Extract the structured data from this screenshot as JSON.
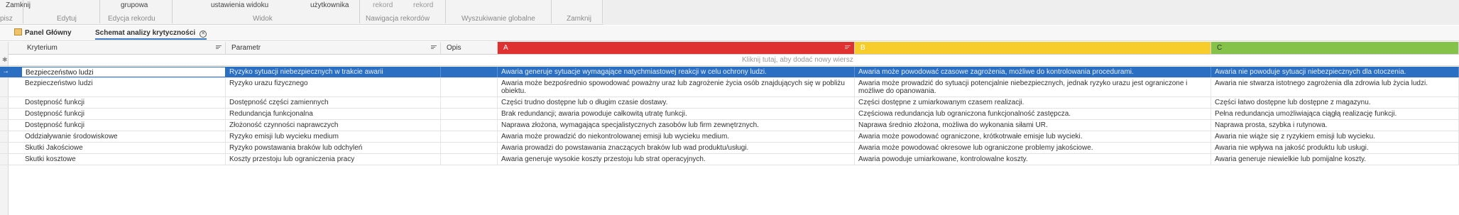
{
  "ribbon": {
    "buttons": {
      "save_close": "Zamknij",
      "grouping": "grupowa",
      "view_settings": "ustawienia widoku",
      "user": "użytkownika",
      "prev_record": "rekord",
      "next_record": "rekord"
    },
    "groups": {
      "write": "pisz",
      "edit": "Edytuj",
      "record_edit": "Edycja rekordu",
      "view": "Widok",
      "record_nav": "Nawigacja rekordów",
      "global_search": "Wyszukiwanie globalne",
      "close": "Zamknij"
    }
  },
  "tabs": [
    {
      "label": "Panel Główny",
      "icon": "panel-icon"
    },
    {
      "label": "Schemat analizy krytyczności",
      "icon": "close-icon"
    }
  ],
  "grid": {
    "columns": {
      "kryterium": "Kryterium",
      "parametr": "Parametr",
      "opis": "Opis",
      "a": "A",
      "b": "B",
      "c": "C"
    },
    "colors": {
      "a": "#e03131",
      "b": "#f7cd2c",
      "c": "#84c24a",
      "selection": "#2a6fc2"
    },
    "new_row_hint": "Kliknij tutaj, aby dodać nowy wiersz",
    "rows": [
      {
        "kryterium": "Bezpieczeństwo ludzi",
        "parametr": "Ryzyko sytuacji niebezpiecznych w trakcie awarii",
        "opis": "",
        "a": "Awaria generuje sytuacje wymagające natychmiastowej reakcji w celu ochrony ludzi.",
        "b": "Awaria może powodować czasowe zagrożenia, możliwe do kontrolowania procedurami.",
        "c": "Awaria nie powoduje sytuacji niebezpiecznych dla otoczenia."
      },
      {
        "kryterium": "Bezpieczeństwo ludzi",
        "parametr": "Ryzyko urazu fizycznego",
        "opis": "",
        "a": "Awaria może bezpośrednio spowodować poważny uraz lub zagrożenie życia osób znajdujących się w pobliżu obiektu.",
        "b": "Awaria może prowadzić do sytuacji potencjalnie niebezpiecznych, jednak ryzyko urazu jest ograniczone i możliwe do opanowania.",
        "c": "Awaria nie stwarza istotnego zagrożenia dla zdrowia lub życia ludzi."
      },
      {
        "kryterium": "Dostępność funkcji",
        "parametr": "Dostępność części zamiennych",
        "opis": "",
        "a": "Części trudno dostępne lub o długim czasie dostawy.",
        "b": "Części dostępne z umiarkowanym czasem realizacji.",
        "c": "Części łatwo dostępne lub dostępne z magazynu."
      },
      {
        "kryterium": "Dostępność funkcji",
        "parametr": "Redundancja funkcjonalna",
        "opis": "",
        "a": "Brak redundancji; awaria powoduje całkowitą utratę funkcji.",
        "b": "Częściowa redundancja lub ograniczona funkcjonalność zastępcza.",
        "c": "Pełna redundancja umożliwiająca ciągłą realizację funkcji."
      },
      {
        "kryterium": "Dostępność funkcji",
        "parametr": "Złożoność czynności naprawczych",
        "opis": "",
        "a": "Naprawa złożona, wymagająca specjalistycznych zasobów lub firm zewnętrznych.",
        "b": "Naprawa średnio złożona, możliwa do wykonania siłami UR.",
        "c": "Naprawa prosta, szybka i rutynowa."
      },
      {
        "kryterium": "Oddziaływanie środowiskowe",
        "parametr": "Ryzyko emisji lub wycieku medium",
        "opis": "",
        "a": "Awaria może prowadzić do niekontrolowanej emisji lub wycieku medium.",
        "b": "Awaria może powodować ograniczone, krótkotrwałe emisje lub wycieki.",
        "c": "Awaria nie wiąże się z ryzykiem emisji lub wycieku."
      },
      {
        "kryterium": "Skutki Jakościowe",
        "parametr": "Ryzyko powstawania braków lub odchyleń",
        "opis": "",
        "a": "Awaria prowadzi do powstawania znaczących braków lub wad produktu/usługi.",
        "b": "Awaria może powodować okresowe lub ograniczone problemy jakościowe.",
        "c": "Awaria nie wpływa na jakość produktu lub usługi."
      },
      {
        "kryterium": "Skutki kosztowe",
        "parametr": "Koszty przestoju lub ograniczenia pracy",
        "opis": "",
        "a": "Awaria generuje wysokie koszty przestoju lub strat operacyjnych.",
        "b": "Awaria powoduje umiarkowane, kontrolowalne koszty.",
        "c": "Awaria generuje niewielkie lub pomijalne koszty."
      }
    ]
  }
}
